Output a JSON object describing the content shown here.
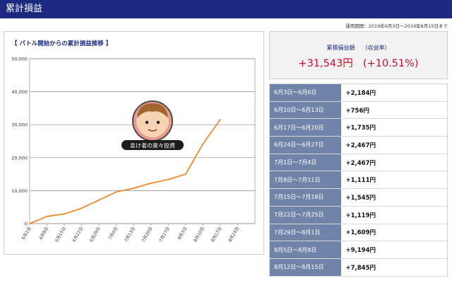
{
  "header": {
    "title": "累計損益"
  },
  "operation_period": "運用期間：2019年6月3日〜2019年8月15日まで",
  "chart_panel": {
    "heading": "【 バトル開始からの累計損益推移 】"
  },
  "watermark": {
    "caption": "怠け者の楽々投資",
    "icon": "avatar-face-icon"
  },
  "summary": {
    "label": "累積損益額",
    "label_sub": "（収益率）",
    "amount": "+31,543円",
    "rate": "(+10.51%)"
  },
  "weekly_results": [
    {
      "period": "6月3日〜6月6日",
      "value": "+2,184円"
    },
    {
      "period": "6月10日〜6月13日",
      "value": "+756円"
    },
    {
      "period": "6月17日〜6月20日",
      "value": "+1,735円"
    },
    {
      "period": "6月24日〜6月27日",
      "value": "+2,467円"
    },
    {
      "period": "7月1日〜7月4日",
      "value": "+2,467円"
    },
    {
      "period": "7月8日〜7月11日",
      "value": "+1,111円"
    },
    {
      "period": "7月15日〜7月18日",
      "value": "+1,545円"
    },
    {
      "period": "7月22日〜7月25日",
      "value": "+1,119円"
    },
    {
      "period": "7月29日〜8月1日",
      "value": "+1,609円"
    },
    {
      "period": "8月5日〜8月8日",
      "value": "+9,194円"
    },
    {
      "period": "8月12日〜8月15日",
      "value": "+7,845円"
    }
  ],
  "colors": {
    "header_bg": "#1b2a80",
    "line": "#f08a2c",
    "profit_text": "#c8102e",
    "table_label_bg": "#6f84a8"
  },
  "chart_data": {
    "type": "line",
    "categories": [
      "6月1日",
      "6月8日",
      "6月15日",
      "6月22日",
      "6月29日",
      "7月6日",
      "7月13日",
      "7月20日",
      "7月27日",
      "8月3日",
      "8月10日",
      "8月17日",
      "8月24日"
    ],
    "series": [
      {
        "values": [
          0,
          2184,
          2940,
          4675,
          7142,
          9609,
          10720,
          12265,
          13384,
          14993,
          24187,
          31543
        ]
      }
    ],
    "yticks": [
      "0",
      "10,000",
      "20,000",
      "30,000",
      "40,000",
      "50,000"
    ],
    "ylim": [
      0,
      50000
    ],
    "grid": true
  }
}
